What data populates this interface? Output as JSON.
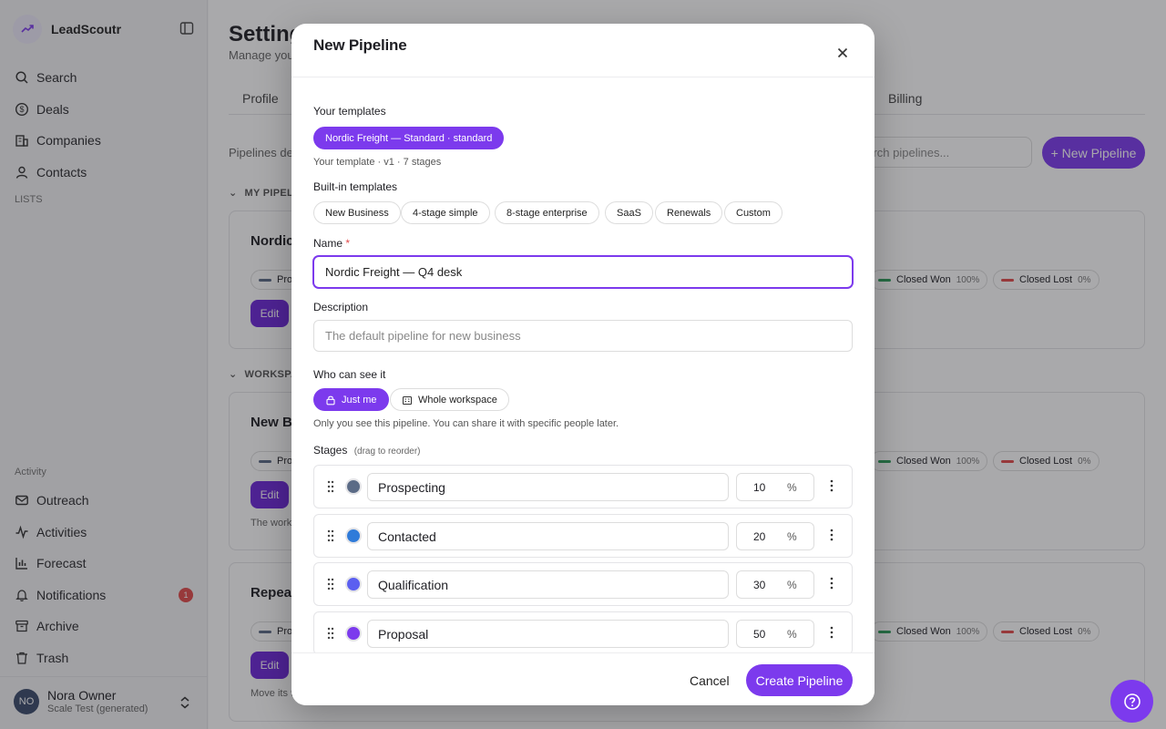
{
  "app": {
    "name": "LeadScoutr"
  },
  "sidebar": {
    "items": [
      {
        "label": "Search",
        "icon": "search-icon"
      },
      {
        "label": "Deals",
        "icon": "dollar-icon"
      },
      {
        "label": "Companies",
        "icon": "building-icon"
      },
      {
        "label": "Contacts",
        "icon": "person-icon"
      }
    ],
    "lists_label": "LISTS",
    "activity_label": "Activity",
    "activity_items": [
      {
        "label": "Outreach",
        "icon": "mail-icon"
      },
      {
        "label": "Activities",
        "icon": "activity-icon"
      },
      {
        "label": "Forecast",
        "icon": "chart-icon"
      },
      {
        "label": "Notifications",
        "icon": "bell-icon",
        "badge": "1"
      },
      {
        "label": "Archive",
        "icon": "archive-icon"
      },
      {
        "label": "Trash",
        "icon": "trash-icon"
      }
    ],
    "user": {
      "initials": "NO",
      "name": "Nora Owner",
      "sub": "Scale Test (generated)"
    }
  },
  "background": {
    "title": "Setting",
    "subtitle": "Manage your",
    "tabs": [
      "Profile",
      "Billing"
    ],
    "pipelines_desc": "Pipelines det",
    "search_placeholder": "earch pipelines...",
    "new_pipeline": "+ New Pipeline",
    "section_my": "MY PIPELI",
    "section_workspace": "WORKSPA",
    "cards": [
      {
        "title": "Nordic",
        "chip_start": "Pro",
        "edit": "Edit",
        "note": ""
      },
      {
        "title": "New Bu",
        "chip_start": "Pro",
        "edit": "Edit",
        "note": "The works"
      },
      {
        "title": "Repeat",
        "chip_start": "Pro",
        "edit": "Edit",
        "note": "Move its 9"
      }
    ],
    "chip_won": {
      "label": "Closed Won",
      "pct": "100%"
    },
    "chip_lost": {
      "label": "Closed Lost",
      "pct": "0%"
    }
  },
  "modal": {
    "title": "New Pipeline",
    "your_templates_label": "Your templates",
    "your_template_pill": "Nordic Freight — Standard · standard",
    "your_template_hint": "Your template · v1 · 7 stages",
    "builtin_label": "Built-in templates",
    "builtin_templates": [
      "New Business",
      "4-stage simple",
      "8-stage enterprise",
      "SaaS",
      "Renewals",
      "Custom"
    ],
    "name_label": "Name",
    "name_required": "*",
    "name_value": "Nordic Freight — Q4 desk",
    "description_label": "Description",
    "description_placeholder": "The default pipeline for new business",
    "visibility_label": "Who can see it",
    "visibility_options": [
      "Just me",
      "Whole workspace"
    ],
    "visibility_hint": "Only you see this pipeline. You can share it with specific people later.",
    "stages_label": "Stages",
    "stages_hint": "(drag to reorder)",
    "stages": [
      {
        "name": "Prospecting",
        "pct": "10",
        "color": "#5b6b86"
      },
      {
        "name": "Contacted",
        "pct": "20",
        "color": "#2f7bd9"
      },
      {
        "name": "Qualification",
        "pct": "30",
        "color": "#5b5ff0"
      },
      {
        "name": "Proposal",
        "pct": "50",
        "color": "#7c3aed"
      }
    ],
    "pct_symbol": "%",
    "cancel": "Cancel",
    "create": "Create Pipeline"
  },
  "colors": {
    "accent": "#7c3aed",
    "danger": "#e24b4b",
    "won": "#2e9e5b"
  }
}
